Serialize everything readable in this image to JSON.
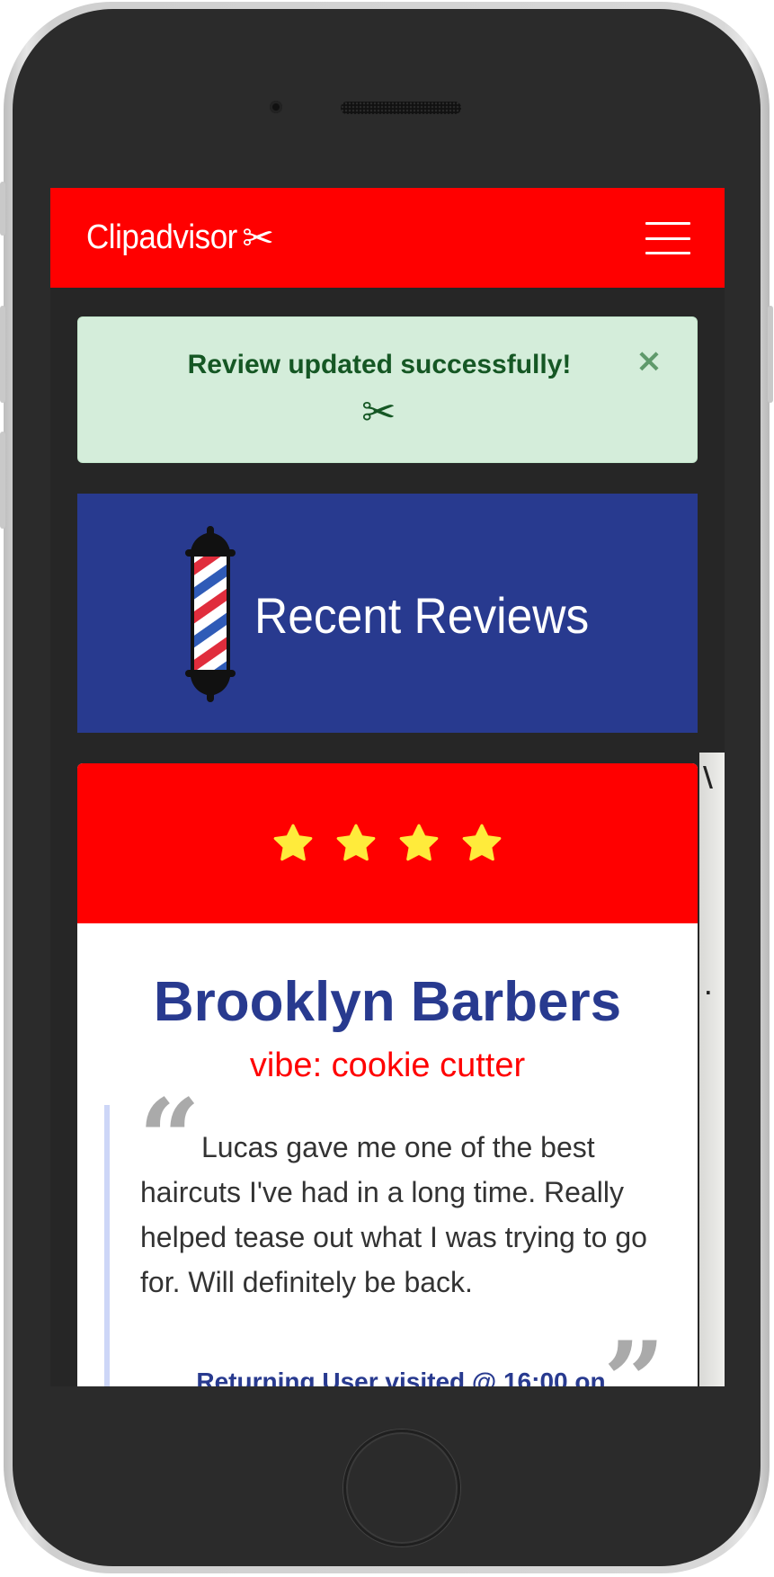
{
  "navbar": {
    "brand": "Clipadvisor",
    "brand_icon": "scissors-icon",
    "menu_icon": "hamburger-menu-icon",
    "color": "#ff0000"
  },
  "alert": {
    "message": "Review updated successfully!",
    "icon": "scissors-icon",
    "close": "×",
    "background": "#d4edda",
    "text_color": "#155724"
  },
  "banner": {
    "title": "Recent Reviews",
    "icon": "barber-pole-icon",
    "background": "#283a8f"
  },
  "review": {
    "rating": 4,
    "shop_name": "Brooklyn Barbers",
    "vibe": "vibe: cookie cutter",
    "text": "Lucas gave me one of the best haircuts I've had in a long time. Really helped tease out what I was trying to go for. Will definitely be back.",
    "meta": "Returning User visited @ 16:00 on",
    "open_quote": "“",
    "close_quote": "”",
    "header_color": "#ff0000",
    "star_color": "#ffeb3b"
  }
}
